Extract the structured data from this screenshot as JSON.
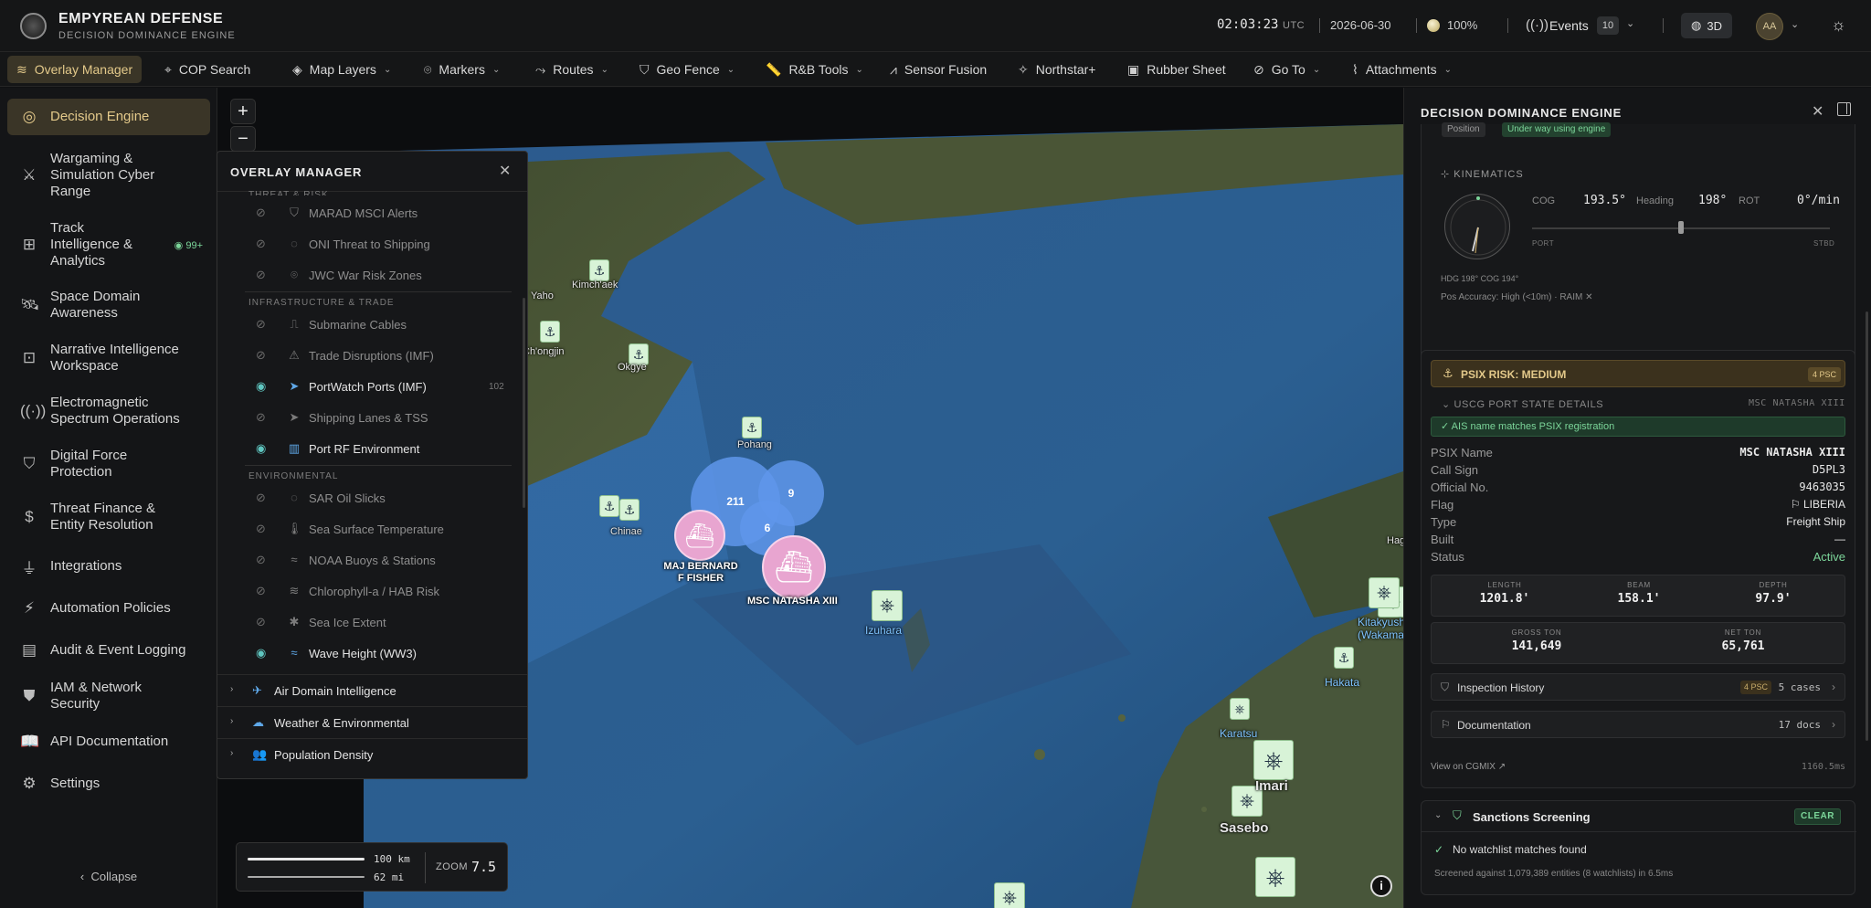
{
  "brand": {
    "title": "EMPYREAN DEFENSE",
    "subtitle": "DECISION DOMINANCE ENGINE"
  },
  "status": {
    "clock": "02:03:23",
    "clock_tz": "UTC",
    "date": "2026-06-30",
    "zoom_pct": "100%",
    "events_label": "Events",
    "events_count": "10",
    "view_mode": "3D",
    "avatar_initials": "AA"
  },
  "toolbar": [
    {
      "label": "Overlay Manager",
      "icon": "layers-icon",
      "active": true,
      "dropdown": false
    },
    {
      "label": "COP Search",
      "icon": "scan-icon",
      "dropdown": false
    },
    {
      "label": "Map Layers",
      "icon": "stack-icon",
      "dropdown": true
    },
    {
      "label": "Markers",
      "icon": "pin-icon",
      "dropdown": true
    },
    {
      "label": "Routes",
      "icon": "route-icon",
      "dropdown": true
    },
    {
      "label": "Geo Fence",
      "icon": "shield-icon",
      "dropdown": true
    },
    {
      "label": "R&B Tools",
      "icon": "ruler-icon",
      "dropdown": true
    },
    {
      "label": "Sensor Fusion",
      "icon": "antenna-icon",
      "dropdown": false
    },
    {
      "label": "Northstar+",
      "icon": "sparkle-icon",
      "dropdown": false
    },
    {
      "label": "Rubber Sheet",
      "icon": "image-icon",
      "dropdown": false
    },
    {
      "label": "Go To",
      "icon": "compass-icon",
      "dropdown": true
    },
    {
      "label": "Attachments",
      "icon": "paperclip-icon",
      "dropdown": true
    }
  ],
  "sidebar": {
    "items": [
      {
        "label": "Decision Engine",
        "icon": "target-icon",
        "active": true
      },
      {
        "label": "Wargaming & Simulation Cyber Range",
        "icon": "swords-icon"
      },
      {
        "label": "Track Intelligence & Analytics",
        "icon": "grid-icon",
        "badge": "99+"
      },
      {
        "label": "Space Domain Awareness",
        "icon": "satellite-icon"
      },
      {
        "label": "Narrative Intelligence Workspace",
        "icon": "message-alert-icon"
      },
      {
        "label": "Electromagnetic Spectrum Operations",
        "icon": "radio-icon"
      },
      {
        "label": "Digital Force Protection",
        "icon": "shield-icon"
      },
      {
        "label": "Threat Finance & Entity Resolution",
        "icon": "dollar-icon"
      },
      {
        "label": "Integrations",
        "icon": "plug-icon"
      },
      {
        "label": "Automation Policies",
        "icon": "automation-icon"
      },
      {
        "label": "Audit & Event Logging",
        "icon": "clipboard-icon"
      },
      {
        "label": "IAM & Network Security",
        "icon": "shield-check-icon"
      },
      {
        "label": "API Documentation",
        "icon": "book-icon"
      },
      {
        "label": "Settings",
        "icon": "gear-icon"
      }
    ],
    "collapse_label": "Collapse"
  },
  "overlay": {
    "title": "OVERLAY MANAGER",
    "partial_section": "THREAT & RISK",
    "layers_a": [
      {
        "name": "MARAD MSCI Alerts",
        "visible": false,
        "icon": "shield-icon"
      },
      {
        "name": "ONI Threat to Shipping",
        "visible": false,
        "icon": "radar-icon"
      },
      {
        "name": "JWC War Risk Zones",
        "visible": false,
        "icon": "pin-icon"
      }
    ],
    "section_b": "INFRASTRUCTURE & TRADE",
    "layers_b": [
      {
        "name": "Submarine Cables",
        "visible": false,
        "icon": "cable-icon"
      },
      {
        "name": "Trade Disruptions (IMF)",
        "visible": false,
        "icon": "warning-icon"
      },
      {
        "name": "PortWatch Ports (IMF)",
        "visible": true,
        "icon": "navigation-icon",
        "count": "102"
      },
      {
        "name": "Shipping Lanes & TSS",
        "visible": false,
        "icon": "navigation-icon"
      },
      {
        "name": "Port RF Environment",
        "visible": true,
        "icon": "building-icon"
      }
    ],
    "section_c": "ENVIRONMENTAL",
    "layers_c": [
      {
        "name": "SAR Oil Slicks",
        "visible": false,
        "icon": "radar-icon"
      },
      {
        "name": "Sea Surface Temperature",
        "visible": false,
        "icon": "thermometer-icon"
      },
      {
        "name": "NOAA Buoys & Stations",
        "visible": false,
        "icon": "waves-icon"
      },
      {
        "name": "Chlorophyll-a / HAB Risk",
        "visible": false,
        "icon": "wind-icon"
      },
      {
        "name": "Sea Ice Extent",
        "visible": false,
        "icon": "snowflake-icon"
      },
      {
        "name": "Wave Height (WW3)",
        "visible": true,
        "icon": "waves-icon"
      }
    ],
    "groups": [
      {
        "name": "Air Domain Intelligence",
        "icon": "plane-icon"
      },
      {
        "name": "Weather & Environmental",
        "icon": "cloud-icon"
      },
      {
        "name": "Population Density",
        "icon": "users-icon"
      }
    ]
  },
  "map": {
    "places": [
      {
        "name": "Yaho"
      },
      {
        "name": "Kimch'aek"
      },
      {
        "name": "Ch'ongjin"
      },
      {
        "name": "Okgye"
      },
      {
        "name": "Pohang"
      },
      {
        "name": "Chinae"
      },
      {
        "name": "Izuhara"
      },
      {
        "name": "Kitakyushu (Wakamatsu)"
      },
      {
        "name": "Hakata"
      },
      {
        "name": "Karatsu"
      },
      {
        "name": "Imari"
      },
      {
        "name": "Sasebo"
      },
      {
        "name": "Hag"
      }
    ],
    "clusters": [
      "211",
      "9",
      "6"
    ],
    "vessels": [
      {
        "name": "MAJ BERNARD F FISHER"
      },
      {
        "name": "MSC NATASHA XIII"
      }
    ],
    "scale_km": "100 km",
    "scale_mi": "62 mi",
    "zoom_label": "ZOOM",
    "zoom_value": "7.5"
  },
  "panel": {
    "title": "DECISION DOMINANCE ENGINE",
    "chips": [
      "Position",
      "Under way using engine"
    ],
    "kinematics": {
      "label": "KINEMATICS",
      "cog_label": "COG",
      "cog": "193.5°",
      "heading_label": "Heading",
      "heading": "198°",
      "rot_label": "ROT",
      "rot": "0°/min",
      "port": "PORT",
      "stbd": "STBD",
      "hdg_cog": "HDG 198° COG 194°",
      "pos_accuracy": "Pos Accuracy: High (<10m) · RAIM ✕"
    },
    "psix": {
      "risk": "PSIX RISK: MEDIUM",
      "psc_badge": "4 PSC",
      "uscg_label": "USCG PORT STATE DETAILS",
      "uscg_ship": "MSC NATASHA XIII",
      "ais_match": "AIS name matches PSIX registration",
      "rows": [
        {
          "k": "PSIX Name",
          "v": "MSC NATASHA XIII"
        },
        {
          "k": "Call Sign",
          "v": "D5PL3"
        },
        {
          "k": "Official No.",
          "v": "9463035"
        },
        {
          "k": "Flag",
          "v": "⚐ LIBERIA"
        },
        {
          "k": "Type",
          "v": "Freight Ship"
        },
        {
          "k": "Built",
          "v": "—"
        },
        {
          "k": "Status",
          "v": "Active"
        }
      ],
      "dims1": [
        {
          "l": "LENGTH",
          "v": "1201.8'"
        },
        {
          "l": "BEAM",
          "v": "158.1'"
        },
        {
          "l": "DEPTH",
          "v": "97.9'"
        }
      ],
      "dims2": [
        {
          "l": "GROSS TON",
          "v": "141,649"
        },
        {
          "l": "NET TON",
          "v": "65,761"
        }
      ],
      "inspection": {
        "label": "Inspection History",
        "tag": "4 PSC",
        "cases": "5 cases"
      },
      "documentation": {
        "label": "Documentation",
        "docs": "17 docs"
      },
      "cgmix": "View on CGMIX ↗",
      "latency": "1160.5ms"
    },
    "sanctions": {
      "title": "Sanctions Screening",
      "badge": "CLEAR",
      "result": "No watchlist matches found",
      "note": "Screened against 1,079,389 entities (8 watchlists) in 6.5ms"
    }
  }
}
